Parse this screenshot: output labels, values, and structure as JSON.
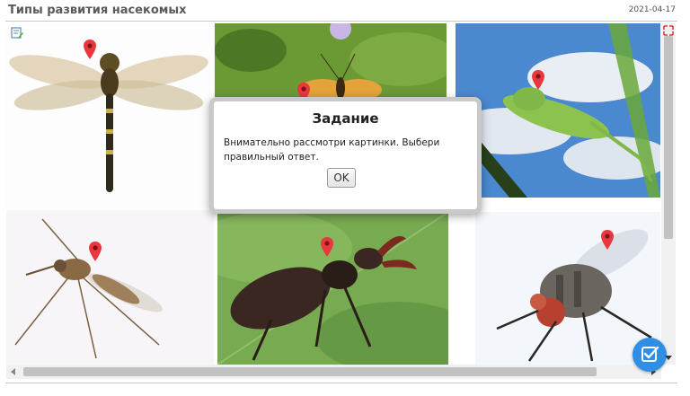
{
  "header": {
    "title": "Типы развития насекомых",
    "date": "2021-04-17"
  },
  "dialog": {
    "title": "Задание",
    "message": "Внимательно рассмотри картинки. Выбери правильный ответ.",
    "ok_label": "OK"
  },
  "images": [
    {
      "name": "dragonfly",
      "icon": "dragonfly-photo"
    },
    {
      "name": "butterfly",
      "icon": "butterfly-photo"
    },
    {
      "name": "grasshopper",
      "icon": "grasshopper-photo"
    },
    {
      "name": "mosquito",
      "icon": "mosquito-photo"
    },
    {
      "name": "stag-beetle",
      "icon": "stag-beetle-photo"
    },
    {
      "name": "fly",
      "icon": "fly-photo"
    }
  ],
  "icons": {
    "pin": "map-pin-icon",
    "edit": "edit-note-icon",
    "fullscreen": "fullscreen-icon",
    "check": "check-badge-icon"
  },
  "colors": {
    "accent": "#2f8fe6",
    "pin": "#e8383d",
    "title": "#5a5a5a"
  }
}
